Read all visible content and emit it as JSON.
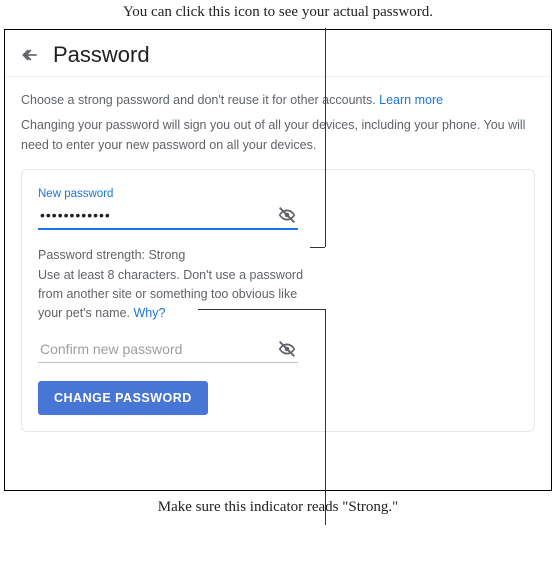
{
  "captions": {
    "top": "You can click this icon to see your actual password.",
    "bottom": "Make sure this indicator reads \"Strong.\""
  },
  "header": {
    "title": "Password"
  },
  "instructions": {
    "line1_a": "Choose a strong password and don't reuse it for other accounts. ",
    "line1_link": "Learn more",
    "line2": "Changing your password will sign you out of all your devices, including your phone. You will need to enter your new password on all your devices."
  },
  "form": {
    "new_password_label": "New password",
    "new_password_value": "••••••••••••",
    "strength_label": "Password strength: ",
    "strength_value": "Strong",
    "hint_a": "Use at least 8 characters. Don't use a password from another site or something too obvious like your pet's name. ",
    "hint_link": "Why?",
    "confirm_placeholder": "Confirm new password",
    "button_label": "CHANGE PASSWORD"
  }
}
